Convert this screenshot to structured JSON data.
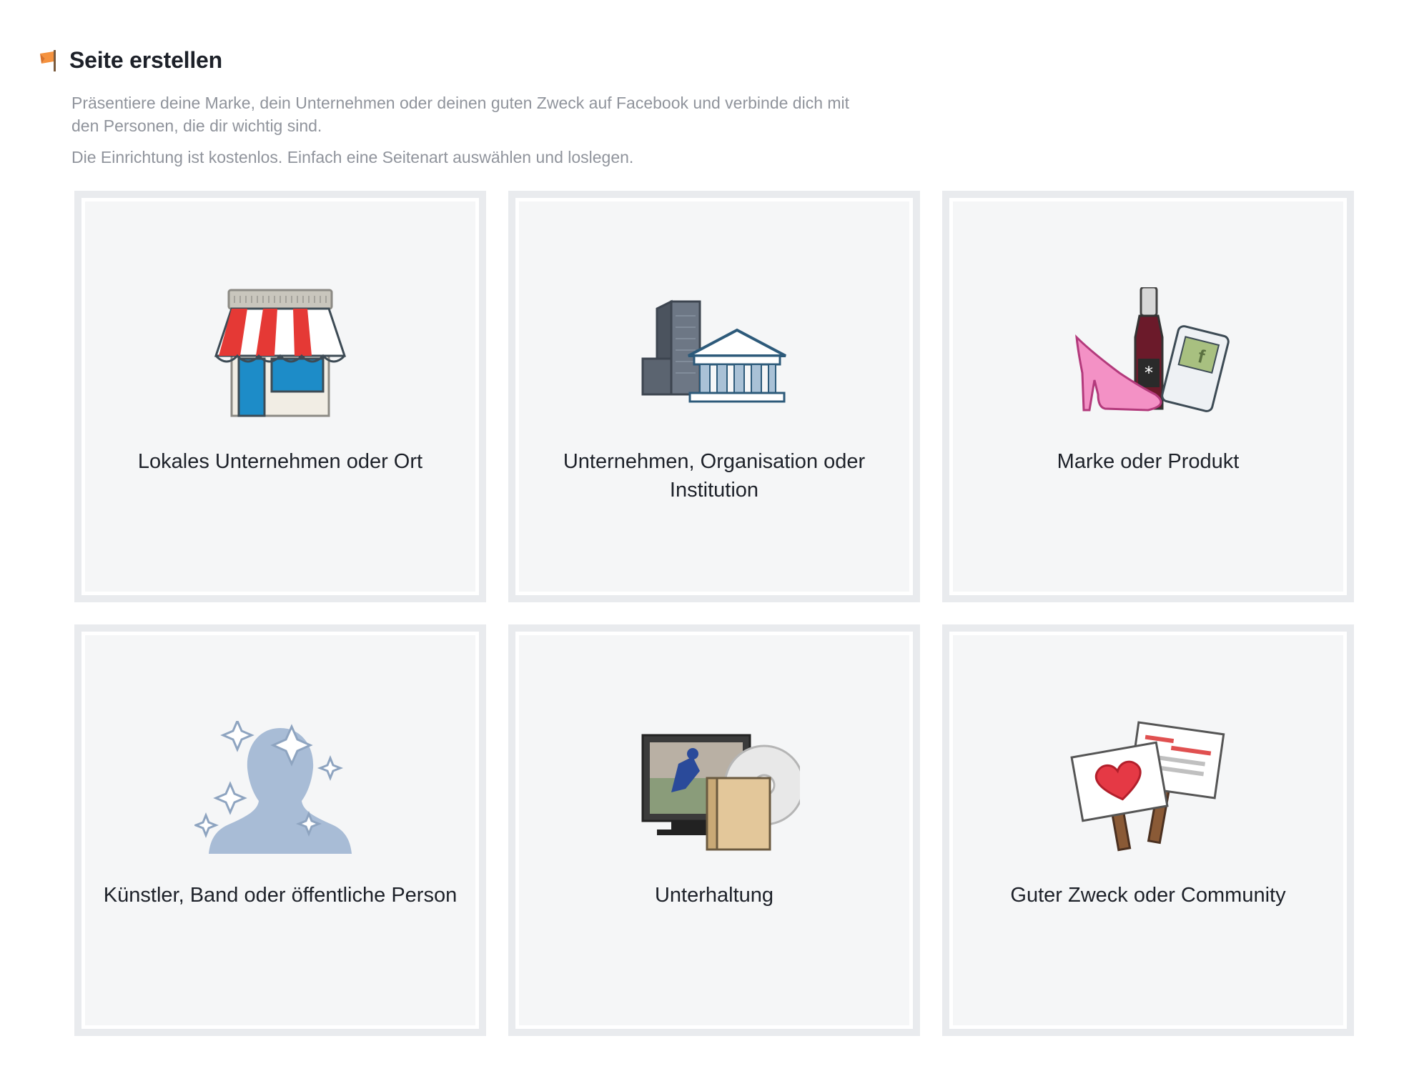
{
  "header": {
    "title": "Seite erstellen",
    "icon": "flag-icon"
  },
  "intro": {
    "line1": "Präsentiere deine Marke, dein Unternehmen oder deinen guten Zweck auf Facebook und verbinde dich mit",
    "line2": "den Personen, die dir wichtig sind.",
    "line3": "Die Einrichtung ist kostenlos. Einfach eine Seitenart auswählen und loslegen."
  },
  "categories": [
    {
      "label": "Lokales Unternehmen oder Ort",
      "icon": "storefront-icon"
    },
    {
      "label": "Unternehmen, Organisation oder Institution",
      "icon": "buildings-icon"
    },
    {
      "label": "Marke oder Produkt",
      "icon": "products-icon"
    },
    {
      "label": "Künstler, Band oder öffentliche Person",
      "icon": "person-sparkle-icon"
    },
    {
      "label": "Unterhaltung",
      "icon": "media-icon"
    },
    {
      "label": "Guter Zweck oder Community",
      "icon": "signs-icon"
    }
  ],
  "colors": {
    "card_border": "#e9ebee",
    "card_fill": "#f5f6f7",
    "title": "#1d2129",
    "muted_text": "#90949c",
    "flag": "#f5923e"
  }
}
